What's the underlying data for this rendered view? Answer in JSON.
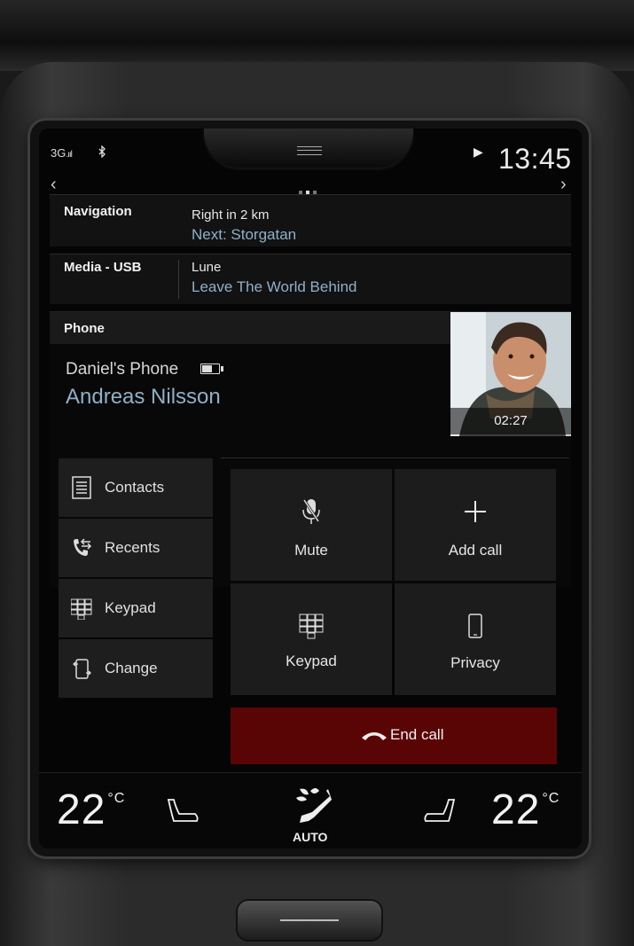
{
  "status": {
    "signal": "3G",
    "bluetooth_icon": "bluetooth-icon",
    "play_icon": "play-icon",
    "time": "13:45",
    "page_indicator": {
      "count": 3,
      "active": 2
    }
  },
  "navigation": {
    "label": "Navigation",
    "instruction": "Right in 2 km",
    "next": "Next: Storgatan"
  },
  "media": {
    "label": "Media - USB",
    "artist": "Lune",
    "track": "Leave The World Behind"
  },
  "phone": {
    "label": "Phone",
    "device": "Daniel's Phone",
    "caller": "Andreas Nilsson",
    "call_duration": "02:27"
  },
  "menu": [
    {
      "label": "Contacts",
      "icon": "contacts-icon"
    },
    {
      "label": "Recents",
      "icon": "recents-icon"
    },
    {
      "label": "Keypad",
      "icon": "keypad-icon"
    },
    {
      "label": "Change",
      "icon": "change-phone-icon"
    }
  ],
  "actions": {
    "mute": "Mute",
    "add_call": "Add call",
    "keypad": "Keypad",
    "privacy": "Privacy",
    "end_call": "End call"
  },
  "climate": {
    "left_temp": "22",
    "right_temp": "22",
    "unit": "°C",
    "fan_mode": "AUTO"
  },
  "colors": {
    "accent_blue": "#8fb0c8",
    "end_call_red": "#5a0505"
  }
}
